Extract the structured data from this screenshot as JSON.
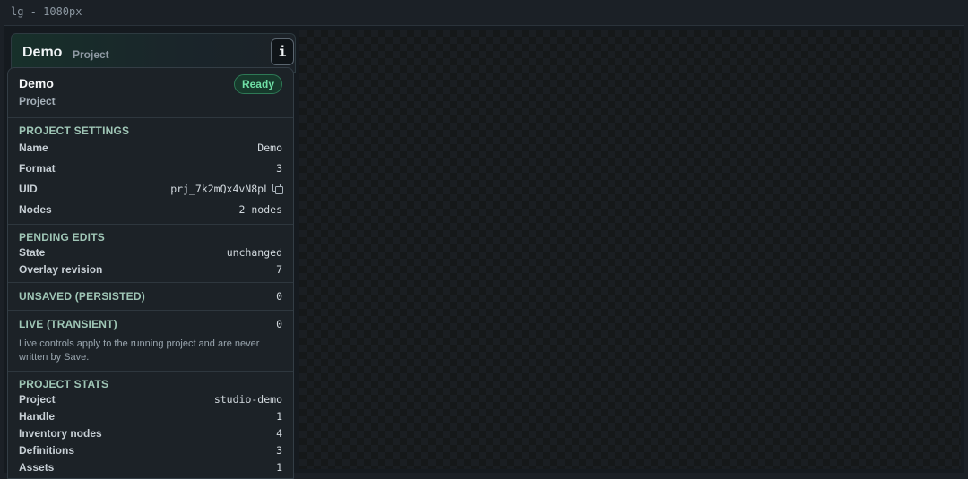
{
  "frame_label": "lg - 1080px",
  "header": {
    "title": "Demo",
    "subtitle": "Project",
    "info_button": "i"
  },
  "panel": {
    "title": "Demo",
    "subtitle": "Project",
    "status_badge": "Ready",
    "project_settings": {
      "title": "PROJECT SETTINGS",
      "rows": [
        {
          "label": "Name",
          "value": "Demo"
        },
        {
          "label": "Format",
          "value": "3"
        },
        {
          "label": "UID",
          "value": "prj_7k2mQx4vN8pL"
        },
        {
          "label": "Nodes",
          "value": "2 nodes"
        }
      ]
    },
    "pending_edits": {
      "title": "PENDING EDITS",
      "rows": [
        {
          "label": "State",
          "value": "unchanged"
        },
        {
          "label": "Overlay revision",
          "value": "7"
        }
      ]
    },
    "unsaved": {
      "title": "UNSAVED (PERSISTED)",
      "value": "0"
    },
    "live": {
      "title": "LIVE (TRANSIENT)",
      "value": "0",
      "note": "Live controls apply to the running project and are never written by Save."
    },
    "project_stats": {
      "title": "PROJECT STATS",
      "rows": [
        {
          "label": "Project",
          "value": "studio-demo"
        },
        {
          "label": "Handle",
          "value": "1"
        },
        {
          "label": "Inventory nodes",
          "value": "4"
        },
        {
          "label": "Definitions",
          "value": "3"
        },
        {
          "label": "Assets",
          "value": "1"
        }
      ]
    }
  },
  "colors": {
    "accent_green": "#6fe0a6",
    "section_title": "#9fc6b6",
    "panel_bg": "#1c2227"
  }
}
